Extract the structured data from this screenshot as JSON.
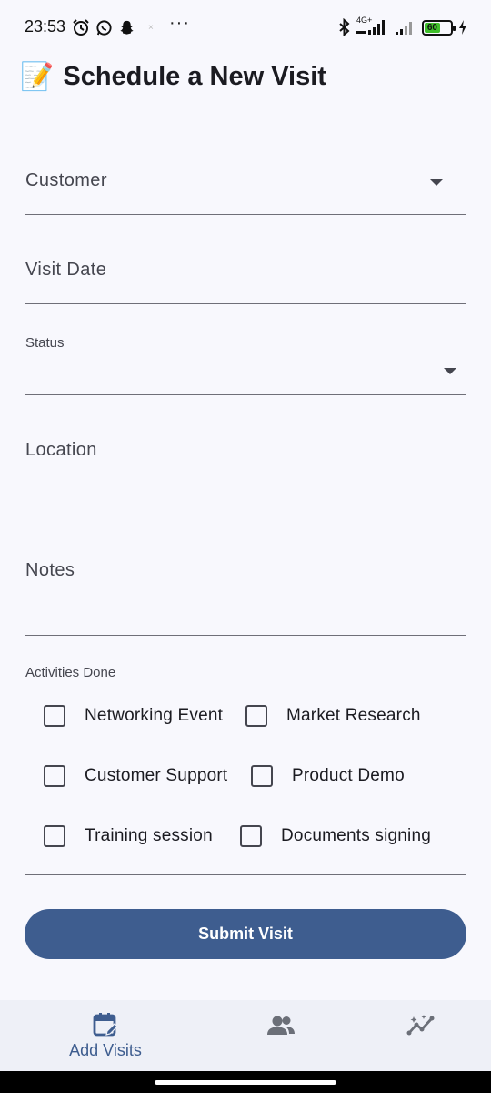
{
  "status_bar": {
    "time": "23:53",
    "dots": "···",
    "network": "4G+",
    "battery": "60"
  },
  "header": {
    "emoji": "📝",
    "title": "Schedule a New Visit"
  },
  "form": {
    "customer": {
      "label": "Customer"
    },
    "visit_date": {
      "label": "Visit Date"
    },
    "status": {
      "label": "Status"
    },
    "location": {
      "label": "Location"
    },
    "notes": {
      "label": "Notes"
    },
    "activities_label": "Activities Done",
    "activities": [
      {
        "label": "Networking Event",
        "checked": false
      },
      {
        "label": "Market Research",
        "checked": false
      },
      {
        "label": "Customer Support",
        "checked": false
      },
      {
        "label": "Product Demo",
        "checked": false
      },
      {
        "label": "Training session",
        "checked": false
      },
      {
        "label": "Documents signing",
        "checked": false
      }
    ],
    "submit_label": "Submit Visit"
  },
  "bottom_nav": {
    "items": [
      {
        "label": "Add Visits",
        "icon": "calendar-edit-icon",
        "active": true
      },
      {
        "label": "",
        "icon": "people-icon",
        "active": false
      },
      {
        "label": "",
        "icon": "insights-icon",
        "active": false
      }
    ]
  },
  "colors": {
    "accent": "#3e5d8f",
    "background": "#f8f8fd",
    "nav_background": "#eef0f7"
  }
}
